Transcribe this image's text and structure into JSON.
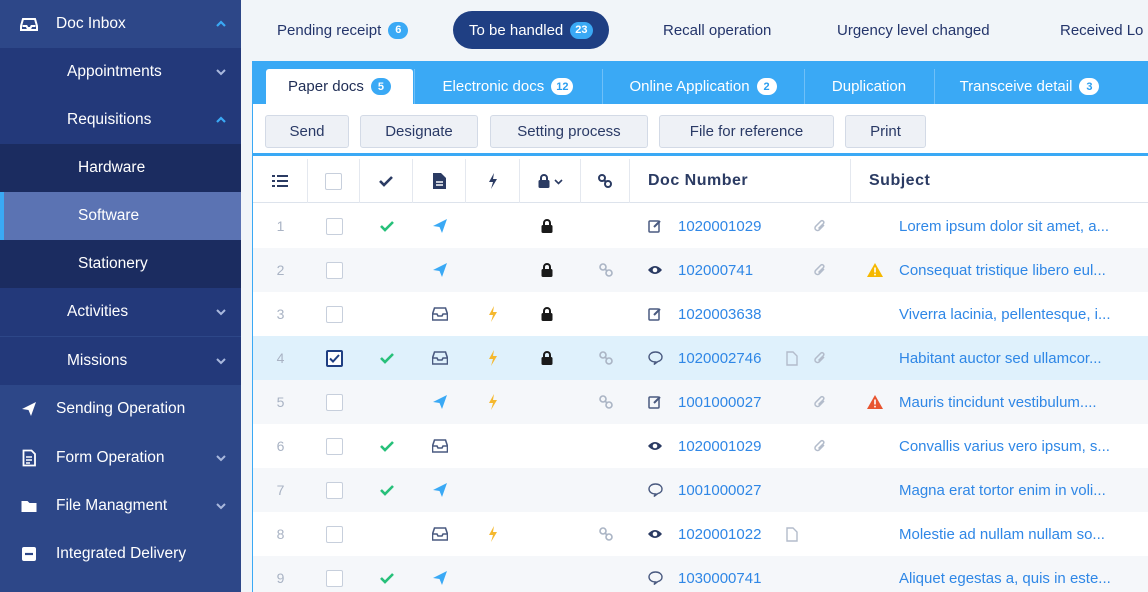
{
  "sidebar": {
    "doc_inbox": "Doc Inbox",
    "appointments": "Appointments",
    "requisitions": "Requisitions",
    "hardware": "Hardware",
    "software": "Software",
    "stationery": "Stationery",
    "activities": "Activities",
    "missions": "Missions",
    "sending_operation": "Sending Operation",
    "form_operation": "Form Operation",
    "file_management": "File Managment",
    "integrated_delivery": "Integrated Delivery"
  },
  "top_tabs": [
    {
      "label": "Pending receipt",
      "count": "6"
    },
    {
      "label": "To be handled",
      "count": "23"
    },
    {
      "label": "Recall operation"
    },
    {
      "label": "Urgency level changed"
    },
    {
      "label": "Received Lo"
    }
  ],
  "doc_tabs": [
    {
      "label": "Paper docs",
      "count": "5"
    },
    {
      "label": "Electronic docs",
      "count": "12"
    },
    {
      "label": "Online Application",
      "count": "2"
    },
    {
      "label": "Duplication"
    },
    {
      "label": "Transceive detail",
      "count": "3"
    }
  ],
  "toolbar": {
    "send": "Send",
    "designate": "Designate",
    "setting_process": "Setting process",
    "file_for_reference": "File for reference",
    "print": "Print"
  },
  "table": {
    "col_doc_number": "Doc Number",
    "col_subject": "Subject",
    "rows": [
      {
        "num": "1",
        "doc": "1020001029",
        "subject": "Lorem ipsum dolor sit amet, a..."
      },
      {
        "num": "2",
        "doc": "102000741",
        "subject": "Consequat tristique libero eul..."
      },
      {
        "num": "3",
        "doc": "1020003638",
        "subject": "Viverra lacinia, pellentesque, i..."
      },
      {
        "num": "4",
        "doc": "1020002746",
        "subject": "Habitant auctor sed ullamcor..."
      },
      {
        "num": "5",
        "doc": "1001000027",
        "subject": "Mauris tincidunt vestibulum...."
      },
      {
        "num": "6",
        "doc": "1020001029",
        "subject": "Convallis varius vero ipsum, s..."
      },
      {
        "num": "7",
        "doc": "1001000027",
        "subject": "Magna erat tortor enim in voli..."
      },
      {
        "num": "8",
        "doc": "1020001022",
        "subject": "Molestie ad nullam nullam so..."
      },
      {
        "num": "9",
        "doc": "1030000741",
        "subject": "Aliquet egestas a, quis in este..."
      }
    ]
  },
  "colors": {
    "sidebar": "#2d4788",
    "accent": "#3aa9f5",
    "active_tab": "#1f3f83",
    "link": "#2f87e6",
    "check": "#27c07a",
    "bolt": "#f5b82e",
    "warn": "#f5b800",
    "alert": "#e8542f"
  }
}
